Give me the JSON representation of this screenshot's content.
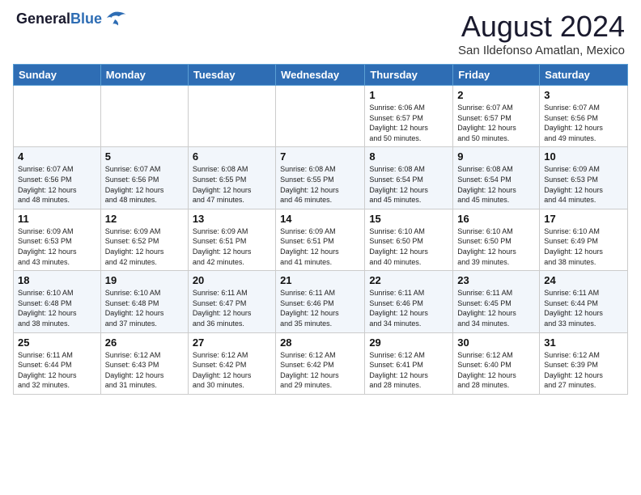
{
  "header": {
    "logo_general": "General",
    "logo_blue": "Blue",
    "month_year": "August 2024",
    "location": "San Ildefonso Amatlan, Mexico"
  },
  "days_of_week": [
    "Sunday",
    "Monday",
    "Tuesday",
    "Wednesday",
    "Thursday",
    "Friday",
    "Saturday"
  ],
  "weeks": [
    [
      {
        "day": "",
        "info": ""
      },
      {
        "day": "",
        "info": ""
      },
      {
        "day": "",
        "info": ""
      },
      {
        "day": "",
        "info": ""
      },
      {
        "day": "1",
        "info": "Sunrise: 6:06 AM\nSunset: 6:57 PM\nDaylight: 12 hours\nand 50 minutes."
      },
      {
        "day": "2",
        "info": "Sunrise: 6:07 AM\nSunset: 6:57 PM\nDaylight: 12 hours\nand 50 minutes."
      },
      {
        "day": "3",
        "info": "Sunrise: 6:07 AM\nSunset: 6:56 PM\nDaylight: 12 hours\nand 49 minutes."
      }
    ],
    [
      {
        "day": "4",
        "info": "Sunrise: 6:07 AM\nSunset: 6:56 PM\nDaylight: 12 hours\nand 48 minutes."
      },
      {
        "day": "5",
        "info": "Sunrise: 6:07 AM\nSunset: 6:56 PM\nDaylight: 12 hours\nand 48 minutes."
      },
      {
        "day": "6",
        "info": "Sunrise: 6:08 AM\nSunset: 6:55 PM\nDaylight: 12 hours\nand 47 minutes."
      },
      {
        "day": "7",
        "info": "Sunrise: 6:08 AM\nSunset: 6:55 PM\nDaylight: 12 hours\nand 46 minutes."
      },
      {
        "day": "8",
        "info": "Sunrise: 6:08 AM\nSunset: 6:54 PM\nDaylight: 12 hours\nand 45 minutes."
      },
      {
        "day": "9",
        "info": "Sunrise: 6:08 AM\nSunset: 6:54 PM\nDaylight: 12 hours\nand 45 minutes."
      },
      {
        "day": "10",
        "info": "Sunrise: 6:09 AM\nSunset: 6:53 PM\nDaylight: 12 hours\nand 44 minutes."
      }
    ],
    [
      {
        "day": "11",
        "info": "Sunrise: 6:09 AM\nSunset: 6:53 PM\nDaylight: 12 hours\nand 43 minutes."
      },
      {
        "day": "12",
        "info": "Sunrise: 6:09 AM\nSunset: 6:52 PM\nDaylight: 12 hours\nand 42 minutes."
      },
      {
        "day": "13",
        "info": "Sunrise: 6:09 AM\nSunset: 6:51 PM\nDaylight: 12 hours\nand 42 minutes."
      },
      {
        "day": "14",
        "info": "Sunrise: 6:09 AM\nSunset: 6:51 PM\nDaylight: 12 hours\nand 41 minutes."
      },
      {
        "day": "15",
        "info": "Sunrise: 6:10 AM\nSunset: 6:50 PM\nDaylight: 12 hours\nand 40 minutes."
      },
      {
        "day": "16",
        "info": "Sunrise: 6:10 AM\nSunset: 6:50 PM\nDaylight: 12 hours\nand 39 minutes."
      },
      {
        "day": "17",
        "info": "Sunrise: 6:10 AM\nSunset: 6:49 PM\nDaylight: 12 hours\nand 38 minutes."
      }
    ],
    [
      {
        "day": "18",
        "info": "Sunrise: 6:10 AM\nSunset: 6:48 PM\nDaylight: 12 hours\nand 38 minutes."
      },
      {
        "day": "19",
        "info": "Sunrise: 6:10 AM\nSunset: 6:48 PM\nDaylight: 12 hours\nand 37 minutes."
      },
      {
        "day": "20",
        "info": "Sunrise: 6:11 AM\nSunset: 6:47 PM\nDaylight: 12 hours\nand 36 minutes."
      },
      {
        "day": "21",
        "info": "Sunrise: 6:11 AM\nSunset: 6:46 PM\nDaylight: 12 hours\nand 35 minutes."
      },
      {
        "day": "22",
        "info": "Sunrise: 6:11 AM\nSunset: 6:46 PM\nDaylight: 12 hours\nand 34 minutes."
      },
      {
        "day": "23",
        "info": "Sunrise: 6:11 AM\nSunset: 6:45 PM\nDaylight: 12 hours\nand 34 minutes."
      },
      {
        "day": "24",
        "info": "Sunrise: 6:11 AM\nSunset: 6:44 PM\nDaylight: 12 hours\nand 33 minutes."
      }
    ],
    [
      {
        "day": "25",
        "info": "Sunrise: 6:11 AM\nSunset: 6:44 PM\nDaylight: 12 hours\nand 32 minutes."
      },
      {
        "day": "26",
        "info": "Sunrise: 6:12 AM\nSunset: 6:43 PM\nDaylight: 12 hours\nand 31 minutes."
      },
      {
        "day": "27",
        "info": "Sunrise: 6:12 AM\nSunset: 6:42 PM\nDaylight: 12 hours\nand 30 minutes."
      },
      {
        "day": "28",
        "info": "Sunrise: 6:12 AM\nSunset: 6:42 PM\nDaylight: 12 hours\nand 29 minutes."
      },
      {
        "day": "29",
        "info": "Sunrise: 6:12 AM\nSunset: 6:41 PM\nDaylight: 12 hours\nand 28 minutes."
      },
      {
        "day": "30",
        "info": "Sunrise: 6:12 AM\nSunset: 6:40 PM\nDaylight: 12 hours\nand 28 minutes."
      },
      {
        "day": "31",
        "info": "Sunrise: 6:12 AM\nSunset: 6:39 PM\nDaylight: 12 hours\nand 27 minutes."
      }
    ]
  ]
}
